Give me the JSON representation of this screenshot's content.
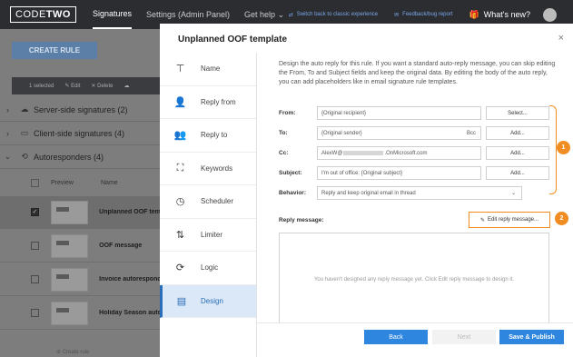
{
  "topbar": {
    "logo_left": "CODE",
    "logo_right": "TWO",
    "nav": [
      "Signatures",
      "Settings (Admin Panel)",
      "Get help"
    ],
    "switch_link": "Switch back to classic experience",
    "feedback_link": "Feedback/bug report",
    "whats_new": "What's new?"
  },
  "background": {
    "create_rule": "CREATE RULE",
    "toolbar": {
      "selected": "1 selected",
      "edit": "Edit",
      "delete": "Delete"
    },
    "groups": [
      {
        "label": "Server-side signatures (2)"
      },
      {
        "label": "Client-side signatures (4)"
      },
      {
        "label": "Autoresponders (4)"
      }
    ],
    "list_headers": {
      "preview": "Preview",
      "name": "Name"
    },
    "rows": [
      {
        "name": "Unplanned OOF template"
      },
      {
        "name": "OOF message"
      },
      {
        "name": "Invoice autoresponder"
      },
      {
        "name": "Holiday Season autoresponder"
      }
    ],
    "create_rule_link": "Create rule"
  },
  "modal": {
    "title": "Unplanned OOF template",
    "close": "×",
    "steps": [
      {
        "label": "Name",
        "icon": "signpost-icon"
      },
      {
        "label": "Reply from",
        "icon": "user-add-icon"
      },
      {
        "label": "Reply to",
        "icon": "users-icon"
      },
      {
        "label": "Keywords",
        "icon": "keywords-icon"
      },
      {
        "label": "Scheduler",
        "icon": "clock-icon"
      },
      {
        "label": "Limiter",
        "icon": "limiter-icon"
      },
      {
        "label": "Logic",
        "icon": "logic-icon"
      },
      {
        "label": "Design",
        "icon": "design-icon"
      }
    ],
    "active_step": "Design",
    "description": "Design the auto reply for this rule. If you want a standard auto-reply message, you can skip editing the From, To and Subject fields and keep the original data. By editing the body of the auto reply, you can add placeholders like in email signature rule templates.",
    "fields": {
      "from": {
        "label": "From:",
        "value": "{Original recipient}",
        "button": "Select..."
      },
      "to": {
        "label": "To:",
        "value": "{Original sender}",
        "bcc": "Bcc",
        "button": "Add..."
      },
      "cc": {
        "label": "Cc:",
        "value_prefix": "AlexW@",
        "value_suffix": ".OnMicrosoft.com",
        "button": "Add..."
      },
      "subject": {
        "label": "Subject:",
        "value": "I'm out of office: {Original subject}",
        "button": "Add..."
      },
      "behavior": {
        "label": "Behavior:",
        "value": "Reply and keep original email in thread"
      }
    },
    "reply_label": "Reply message:",
    "edit_reply": "Edit reply message...",
    "empty_reply": "You haven't designed any reply message yet. Click Edit reply message to design it.",
    "callouts": [
      "1",
      "2"
    ],
    "footer": {
      "back": "Back",
      "next": "Next",
      "publish": "Save & Publish"
    }
  },
  "colors": {
    "accent": "#2e86de",
    "callout": "#f08c22",
    "topbar": "#2b2d31"
  }
}
